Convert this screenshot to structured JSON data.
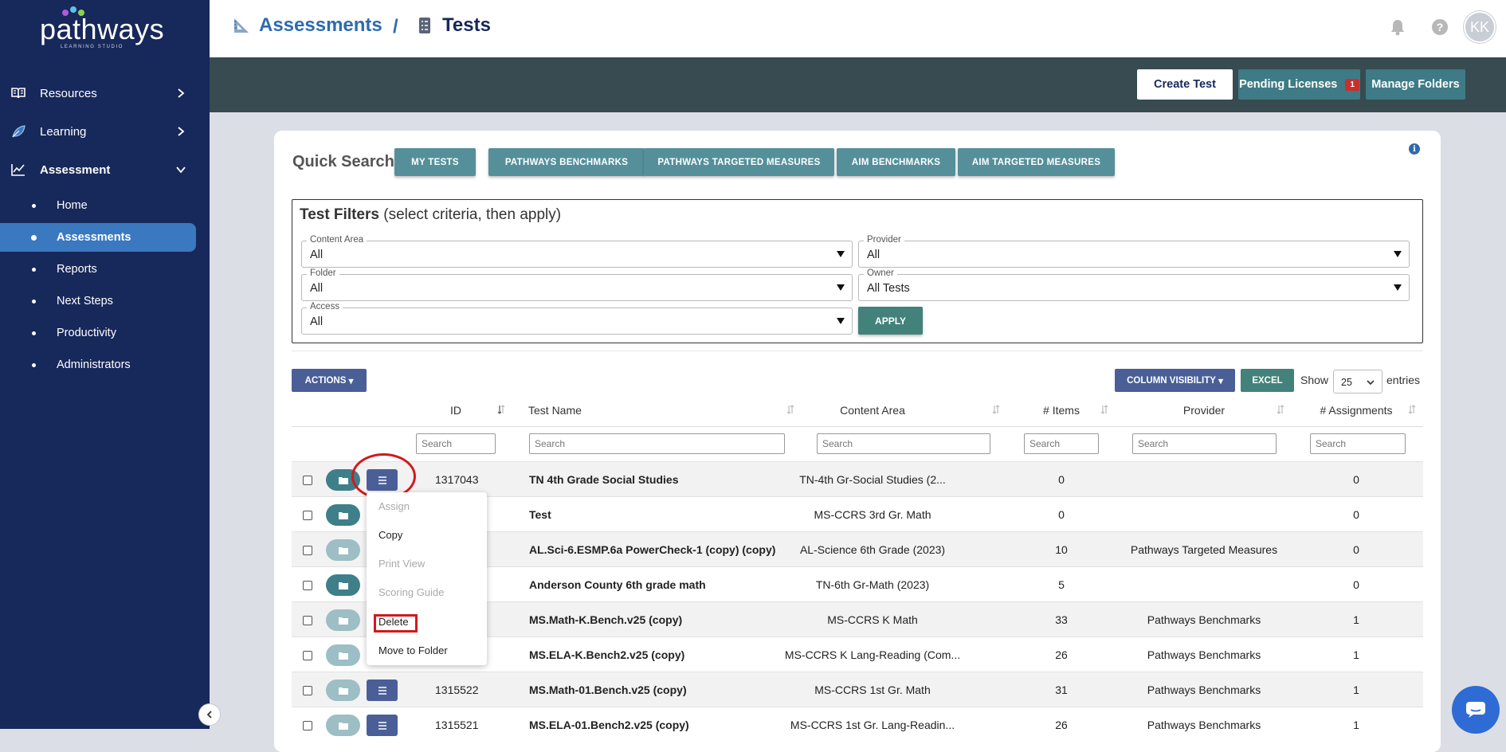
{
  "brand": {
    "name": "pathways",
    "subtitle": "LEARNING STUDIO"
  },
  "sidebar": {
    "items": [
      {
        "label": "Resources"
      },
      {
        "label": "Learning"
      },
      {
        "label": "Assessment"
      }
    ],
    "subitems": [
      {
        "label": "Home"
      },
      {
        "label": "Assessments",
        "active": true
      },
      {
        "label": "Reports"
      },
      {
        "label": "Next Steps"
      },
      {
        "label": "Productivity"
      },
      {
        "label": "Administrators"
      }
    ]
  },
  "header": {
    "breadcrumb": [
      "Assessments",
      "Tests"
    ],
    "separator": "/",
    "avatar_initials": "KK"
  },
  "actionbar": {
    "create_label": "Create Test",
    "pending_label": "Pending Licenses",
    "pending_count": "1",
    "manage_label": "Manage Folders"
  },
  "quick_search": {
    "label": "Quick Search",
    "buttons": [
      "MY TESTS",
      "PATHWAYS BENCHMARKS",
      "PATHWAYS TARGETED MEASURES",
      "AIM BENCHMARKS",
      "AIM TARGETED MEASURES"
    ]
  },
  "filters": {
    "title": "Test Filters",
    "title_hint": "(select criteria, then apply)",
    "content_area": {
      "label": "Content Area",
      "value": "All"
    },
    "provider": {
      "label": "Provider",
      "value": "All"
    },
    "folder": {
      "label": "Folder",
      "value": "All"
    },
    "owner": {
      "label": "Owner",
      "value": "All Tests"
    },
    "access": {
      "label": "Access",
      "value": "All"
    },
    "apply_label": "APPLY"
  },
  "table_controls": {
    "actions_label": "ACTIONS",
    "colvis_label": "COLUMN VISIBILITY",
    "excel_label": "EXCEL",
    "show_label": "Show",
    "page_size": "25",
    "entries_label": "entries",
    "search_placeholder": "Search"
  },
  "table": {
    "columns": [
      "ID",
      "Test Name",
      "Content Area",
      "# Items",
      "Provider",
      "# Assignments"
    ],
    "rows": [
      {
        "id": "1317043",
        "name": "TN 4th Grade Social Studies",
        "content_area": "TN-4th Gr-Social Studies (2...",
        "items": "0",
        "provider": "",
        "assignments": "0"
      },
      {
        "id": "",
        "name": "Test",
        "content_area": "MS-CCRS 3rd Gr. Math",
        "items": "0",
        "provider": "",
        "assignments": "0"
      },
      {
        "id": "",
        "name": "AL.Sci-6.ESMP.6a PowerCheck-1 (copy) (copy)",
        "content_area": "AL-Science 6th Grade (2023)",
        "items": "10",
        "provider": "Pathways Targeted Measures",
        "assignments": "0"
      },
      {
        "id": "",
        "name": "Anderson County 6th grade math",
        "content_area": "TN-6th Gr-Math (2023)",
        "items": "5",
        "provider": "",
        "assignments": "0"
      },
      {
        "id": "",
        "name": "MS.Math-K.Bench.v25 (copy)",
        "content_area": "MS-CCRS K Math",
        "items": "33",
        "provider": "Pathways Benchmarks",
        "assignments": "1"
      },
      {
        "id": "",
        "name": "MS.ELA-K.Bench2.v25 (copy)",
        "content_area": "MS-CCRS K Lang-Reading (Com...",
        "items": "26",
        "provider": "Pathways Benchmarks",
        "assignments": "1"
      },
      {
        "id": "1315522",
        "name": "MS.Math-01.Bench.v25 (copy)",
        "content_area": "MS-CCRS 1st Gr. Math",
        "items": "31",
        "provider": "Pathways Benchmarks",
        "assignments": "1"
      },
      {
        "id": "1315521",
        "name": "MS.ELA-01.Bench2.v25 (copy)",
        "content_area": "MS-CCRS 1st Gr. Lang-Readin...",
        "items": "26",
        "provider": "Pathways Benchmarks",
        "assignments": "1"
      }
    ]
  },
  "row_menu": {
    "items": [
      {
        "label": "Assign",
        "disabled": true
      },
      {
        "label": "Copy",
        "disabled": false
      },
      {
        "label": "Print View",
        "disabled": true
      },
      {
        "label": "Scoring Guide",
        "disabled": true
      },
      {
        "label": "Delete",
        "disabled": false
      },
      {
        "label": "Move to Folder",
        "disabled": false
      }
    ]
  },
  "colors": {
    "sidebar": "#17285a",
    "active": "#3a78c0",
    "teal": "#55909a",
    "annotation": "#d2191c"
  }
}
